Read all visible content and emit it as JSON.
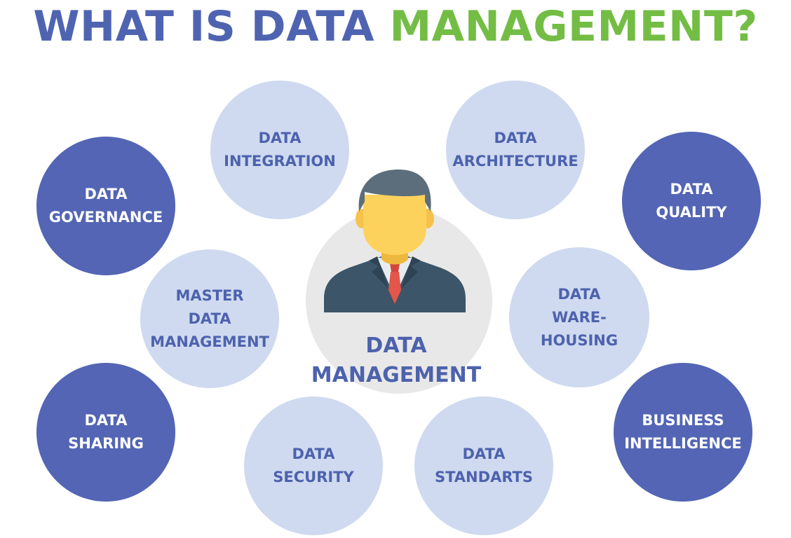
{
  "title": {
    "part1": "WHAT IS DATA",
    "part2": "MANAGEMENT?"
  },
  "center": {
    "line1": "DATA",
    "line2": "MANAGEMENT"
  },
  "nodes": {
    "data_integration": {
      "lines": [
        "DATA",
        "INTEGRATION"
      ]
    },
    "data_architecture": {
      "lines": [
        "DATA",
        "ARCHITECTURE"
      ]
    },
    "data_governance": {
      "lines": [
        "DATA",
        "GOVERNANCE"
      ]
    },
    "data_quality": {
      "lines": [
        "DATA",
        "QUALITY"
      ]
    },
    "master_data_management": {
      "lines": [
        "MASTER",
        "DATA",
        "MANAGEMENT"
      ]
    },
    "data_warehousing": {
      "lines": [
        "DATA",
        "WARE-",
        "HOUSING"
      ]
    },
    "data_sharing": {
      "lines": [
        "DATA",
        "SHARING"
      ]
    },
    "business_intelligence": {
      "lines": [
        "BUSINESS",
        "INTELLIGENCE"
      ]
    },
    "data_security": {
      "lines": [
        "DATA",
        "SECURITY"
      ]
    },
    "data_standarts": {
      "lines": [
        "DATA",
        "STANDARTS"
      ]
    }
  },
  "colors": {
    "title_blue": "#4f64b1",
    "title_green": "#73bd45",
    "dark_circle": "#5365b4",
    "light_circle": "#cfdaf0",
    "light_circle_text": "#4d62ad",
    "center_disc": "#e8e8e8"
  },
  "icons": {
    "center": "businessman-icon"
  }
}
